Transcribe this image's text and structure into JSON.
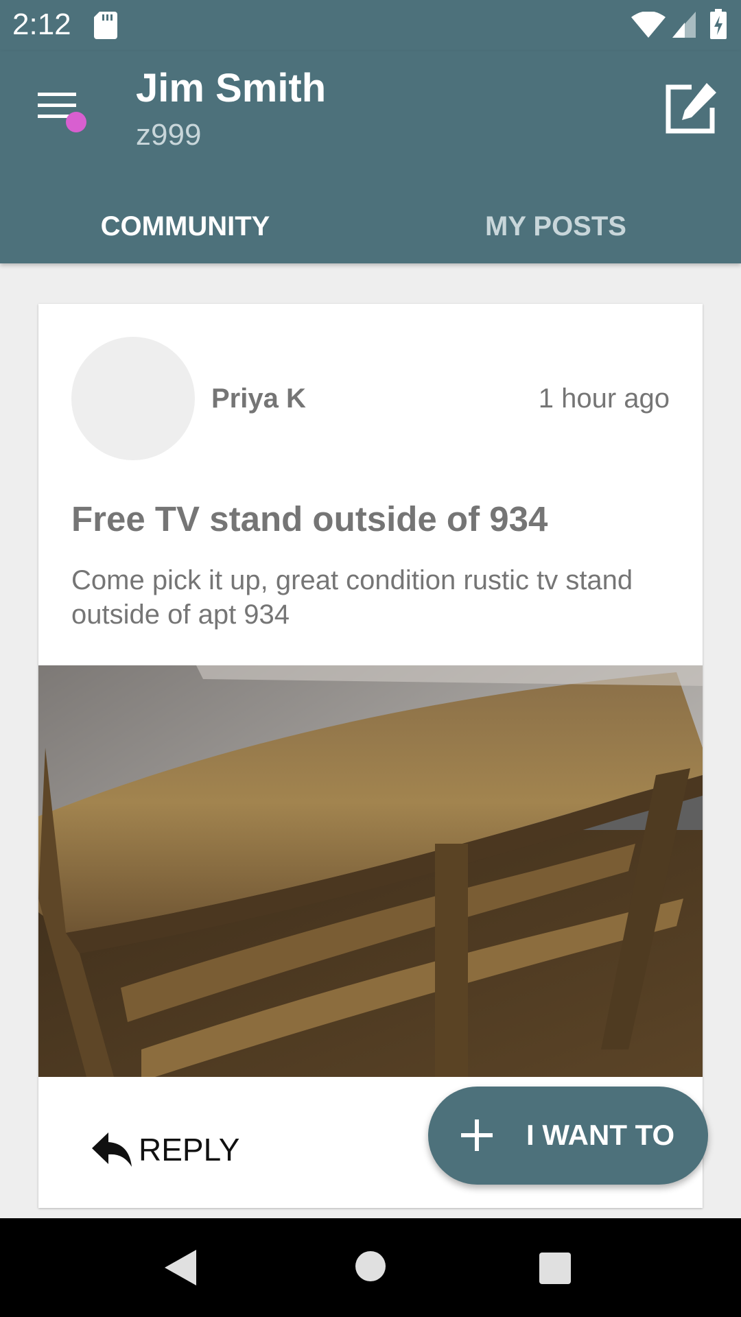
{
  "status_bar": {
    "time": "2:12",
    "icons": [
      "sd-card-icon",
      "wifi-icon",
      "signal-icon",
      "battery-charging-icon"
    ]
  },
  "header": {
    "menu_icon": "hamburger-menu-icon",
    "notification_dot_color": "#d85fd0",
    "user_name": "Jim Smith",
    "user_id": "z999",
    "compose_icon": "compose-icon"
  },
  "tabs": [
    {
      "label": "COMMUNITY",
      "selected": true
    },
    {
      "label": "MY POSTS",
      "selected": false
    }
  ],
  "post": {
    "author": "Priya K",
    "timestamp": "1 hour ago",
    "title": "Free TV stand outside of 934",
    "body": "Come pick it up, great condition rustic tv stand outside of apt 934",
    "reply_label": "REPLY",
    "reply_icon": "reply-arrow-icon"
  },
  "fab": {
    "label": "I WANT TO",
    "icon": "plus-icon"
  },
  "nav_bar": {
    "icons": [
      "back-icon",
      "home-icon",
      "recents-icon"
    ]
  },
  "colors": {
    "primary": "#4d717b",
    "background": "#eeeeee",
    "text_secondary": "#757575",
    "accent_dot": "#d85fd0"
  }
}
